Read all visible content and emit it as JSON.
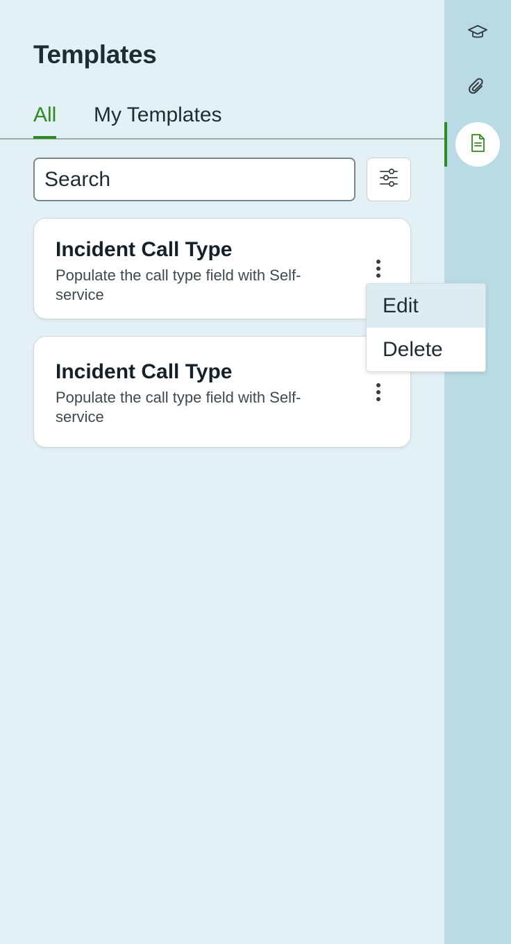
{
  "header": {
    "title": "Templates"
  },
  "tabs": [
    {
      "label": "All",
      "selected": true
    },
    {
      "label": "My Templates",
      "selected": false
    }
  ],
  "search": {
    "placeholder": "Search",
    "value": ""
  },
  "filter": {
    "icon": "sliders-icon"
  },
  "cards": [
    {
      "title": "Incident Call Type",
      "description": "Populate the call type field with Self-service"
    },
    {
      "title": "Incident Call Type",
      "description": "Populate the call type field with Self-service"
    }
  ],
  "menu": {
    "items": [
      {
        "label": "Edit",
        "highlighted": true
      },
      {
        "label": "Delete",
        "highlighted": false
      }
    ]
  },
  "rail": {
    "items": [
      {
        "icon": "graduation-cap-icon",
        "selected": false
      },
      {
        "icon": "paperclip-icon",
        "selected": false
      },
      {
        "icon": "document-icon",
        "selected": true
      }
    ]
  },
  "colors": {
    "accent": "#2e8b1f",
    "panel_bg": "#e3f0f5",
    "rail_bg": "#badbe4"
  }
}
